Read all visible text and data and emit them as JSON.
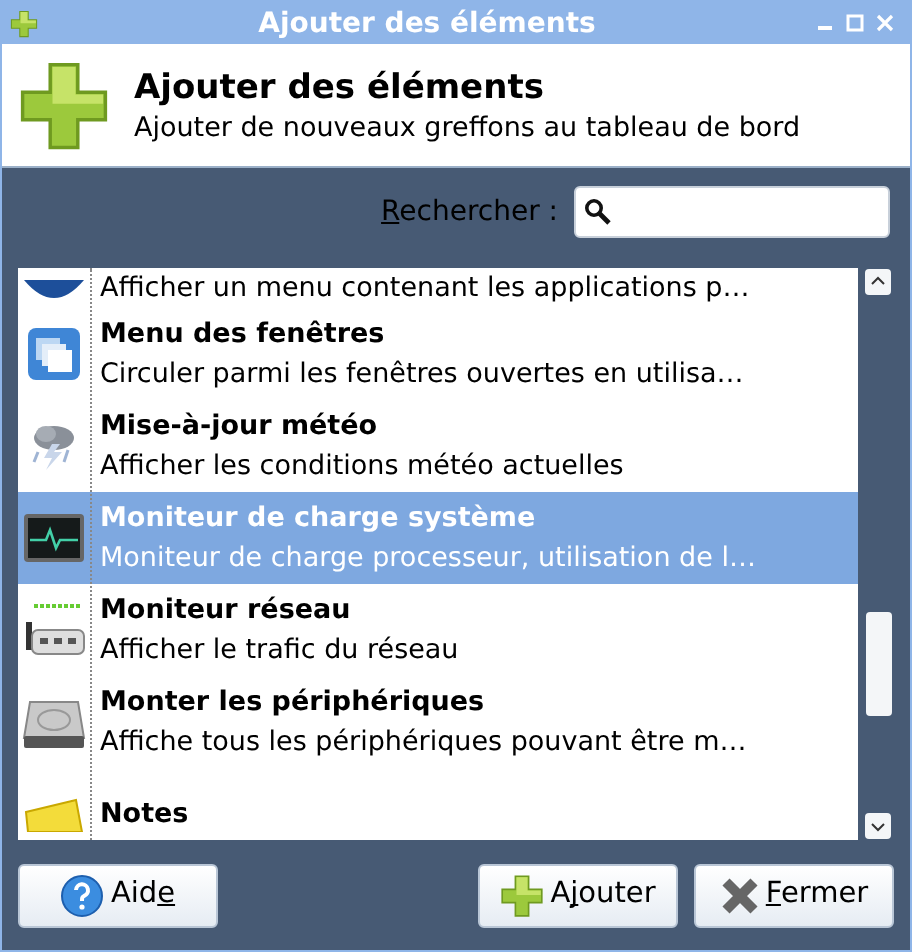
{
  "window": {
    "title": "Ajouter des éléments"
  },
  "header": {
    "title": "Ajouter des éléments",
    "subtitle": "Ajouter de nouveaux greffons au tableau de bord"
  },
  "search": {
    "label": [
      {
        "text": "R",
        "underlined": true
      },
      {
        "text": "echercher :",
        "underlined": false
      }
    ]
  },
  "plugins": [
    {
      "kind": "menu",
      "description": "Afficher un menu contenant les applications p…",
      "selected": false
    },
    {
      "kind": "windows",
      "name": "Menu des fenêtres",
      "description": "Circuler parmi les fenêtres ouvertes en utilisa…",
      "selected": false
    },
    {
      "kind": "weather",
      "name": "Mise-à-jour météo",
      "description": "Afficher les conditions météo actuelles",
      "selected": false
    },
    {
      "kind": "monitor",
      "name": "Moniteur de charge système",
      "description": "Moniteur de charge processeur, utilisation de l…",
      "selected": true
    },
    {
      "kind": "network",
      "name": "Moniteur réseau",
      "description": "Afficher le trafic du réseau",
      "selected": false
    },
    {
      "kind": "drive",
      "name": "Monter les périphériques",
      "description": "Affiche tous les périphériques pouvant être m…",
      "selected": false
    },
    {
      "kind": "notes",
      "name": "Notes",
      "selected": false
    }
  ],
  "buttons": [
    {
      "kind": "help",
      "label": [
        {
          "text": "Aid",
          "underlined": false
        },
        {
          "text": "e",
          "underlined": true
        }
      ]
    },
    {
      "kind": "add",
      "label": [
        {
          "text": "A",
          "underlined": false
        },
        {
          "text": "j",
          "underlined": true
        },
        {
          "text": "outer",
          "underlined": false
        }
      ]
    },
    {
      "kind": "close",
      "label": [
        {
          "text": "F",
          "underlined": true
        },
        {
          "text": "ermer",
          "underlined": false
        }
      ]
    }
  ]
}
